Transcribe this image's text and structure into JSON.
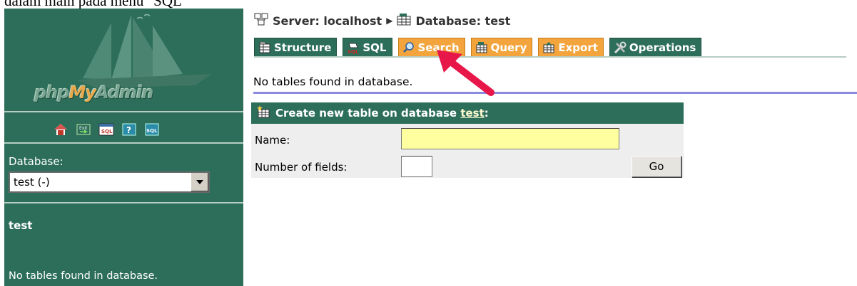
{
  "caption": "dalam main pada menu \"SQL\"",
  "sidebar": {
    "logo": "phpMyAdmin",
    "icons": [
      "home-icon",
      "exit-icon",
      "sql-query-icon",
      "help-icon",
      "sql-docs-icon"
    ],
    "database_label": "Database:",
    "database_select_value": "test (-)",
    "database_name": "test",
    "no_tables_text": "No tables found in database."
  },
  "breadcrumb": {
    "server": "Server: localhost",
    "separator": "▶",
    "database": "Database: test"
  },
  "tabs": [
    {
      "label": "Structure",
      "color": "green"
    },
    {
      "label": "SQL",
      "color": "green"
    },
    {
      "label": "Search",
      "color": "orange"
    },
    {
      "label": "Query",
      "color": "orange"
    },
    {
      "label": "Export",
      "color": "orange"
    },
    {
      "label": "Operations",
      "color": "green"
    }
  ],
  "main": {
    "no_tables_text": "No tables found in database.",
    "create_table": {
      "header_prefix": "Create new table on database ",
      "header_db": "test",
      "header_suffix": ":",
      "name_label": "Name:",
      "name_value": "",
      "fields_label": "Number of fields:",
      "fields_value": "",
      "go_label": "Go"
    }
  },
  "colors": {
    "panel": "#2d6e5a",
    "tab_orange": "#f3a43c",
    "arrow": "#e8174a",
    "name_input": "#ffffa0"
  }
}
